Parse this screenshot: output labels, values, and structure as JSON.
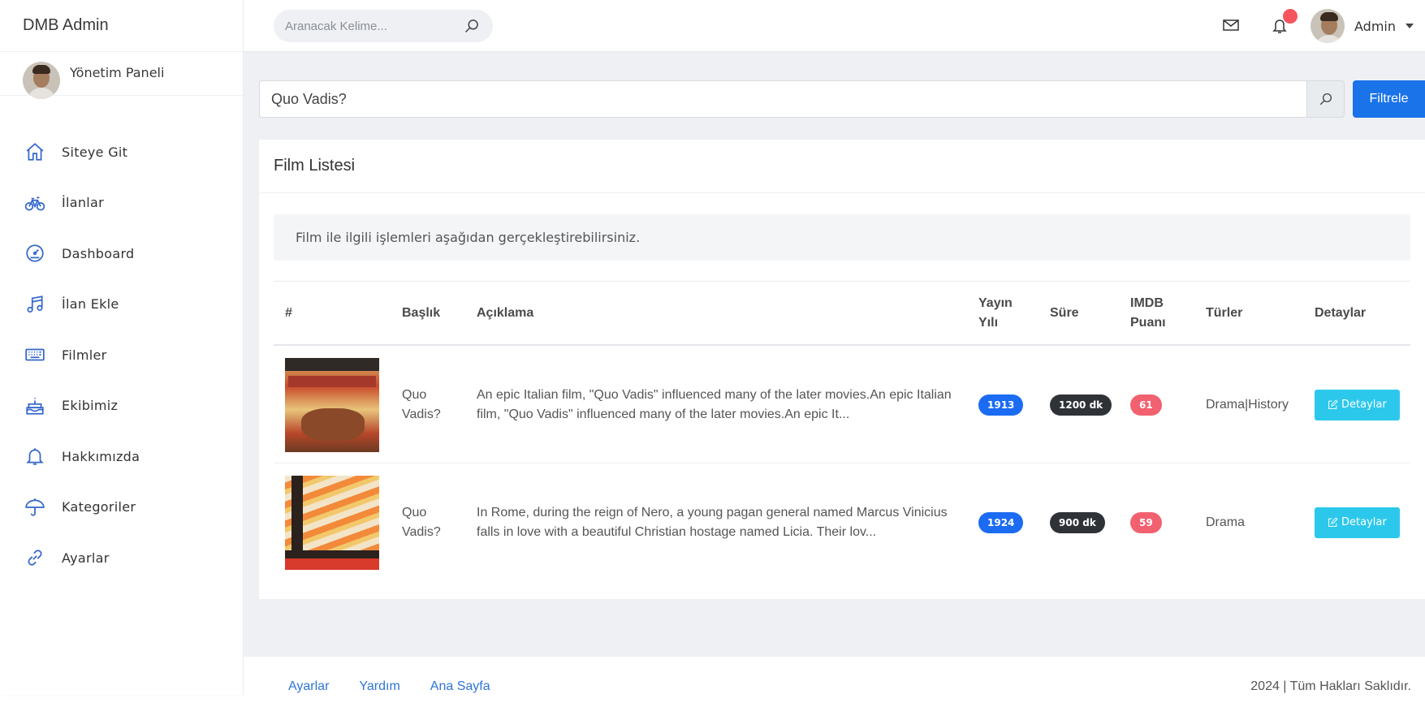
{
  "brand": {
    "title": "DMB Admin"
  },
  "sidebar": {
    "user_label": "Yönetim Paneli",
    "items": [
      {
        "label": "Siteye Git",
        "icon": "home-icon"
      },
      {
        "label": "İlanlar",
        "icon": "bicycle-icon"
      },
      {
        "label": "Dashboard",
        "icon": "speedometer-icon"
      },
      {
        "label": "İlan Ekle",
        "icon": "music-note-icon"
      },
      {
        "label": "Filmler",
        "icon": "keyboard-icon"
      },
      {
        "label": "Ekibimiz",
        "icon": "cake-icon"
      },
      {
        "label": "Hakkımızda",
        "icon": "bell-icon"
      },
      {
        "label": "Kategoriler",
        "icon": "umbrella-icon"
      },
      {
        "label": "Ayarlar",
        "icon": "link-icon"
      }
    ]
  },
  "topbar": {
    "search_placeholder": "Aranacak Kelime...",
    "admin_name": "Admin"
  },
  "filter": {
    "value": "Quo Vadis?",
    "button_label": "Filtrele"
  },
  "card": {
    "title": "Film Listesi",
    "info": "Film ile ilgili işlemleri aşağıdan gerçekleştirebilirsiniz.",
    "columns": {
      "num": "#",
      "title": "Başlık",
      "desc": "Açıklama",
      "year": "Yayın Yılı",
      "duration": "Süre",
      "imdb": "IMDB Puanı",
      "genres": "Türler",
      "details": "Detaylar"
    },
    "rows": [
      {
        "title": "Quo Vadis?",
        "desc": "An epic Italian film, \"Quo Vadis\" influenced many of the later movies.An epic Italian film, \"Quo Vadis\" influenced many of the later movies.An epic It...",
        "year": "1913",
        "duration": "1200 dk",
        "imdb": "61",
        "genres": "Drama|History",
        "detail_label": "Detaylar"
      },
      {
        "title": "Quo Vadis?",
        "desc": "In Rome, during the reign of Nero, a young pagan general named Marcus Vinicius falls in love with a beautiful Christian hostage named Licia. Their lov...",
        "year": "1924",
        "duration": "900 dk",
        "imdb": "59",
        "genres": "Drama",
        "detail_label": "Detaylar"
      }
    ]
  },
  "footer": {
    "links": [
      "Ayarlar",
      "Yardım",
      "Ana Sayfa"
    ],
    "copyright": "2024 | Tüm Hakları Saklıdır."
  },
  "colors": {
    "accent": "#1a73e8",
    "info_button": "#2cc8ec",
    "badge_year": "#1b6cf2",
    "badge_duration": "#2f3338",
    "badge_imdb": "#f26170",
    "notification": "#f7545e",
    "background": "#eef0f4"
  }
}
